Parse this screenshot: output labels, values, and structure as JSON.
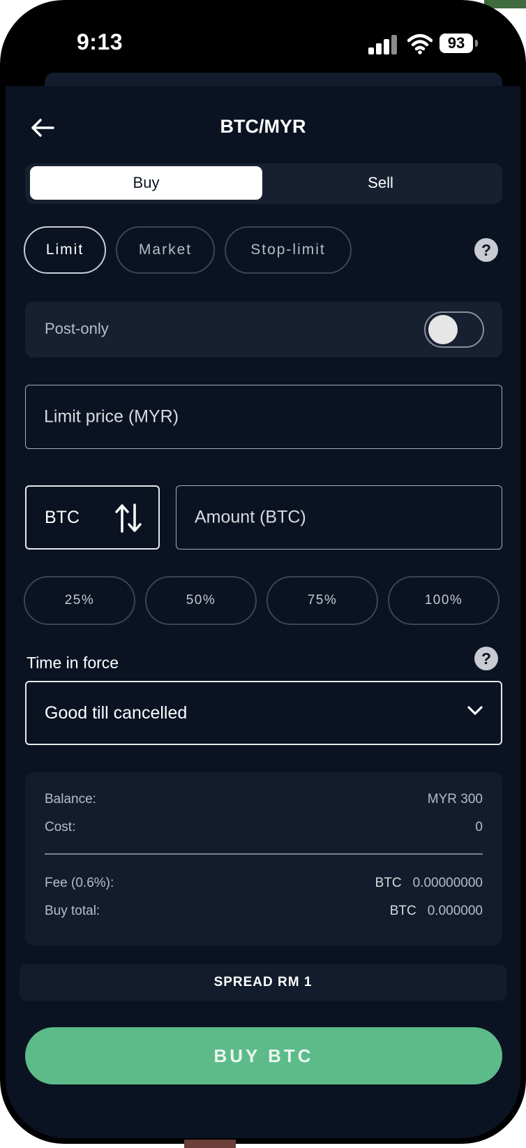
{
  "status_bar": {
    "time": "9:13",
    "battery": "93"
  },
  "header": {
    "title": "BTC/MYR"
  },
  "side_toggle": {
    "buy_label": "Buy",
    "sell_label": "Sell",
    "selected": "Buy"
  },
  "order_types": {
    "items": [
      {
        "label": "Limit",
        "active": true
      },
      {
        "label": "Market",
        "active": false
      },
      {
        "label": "Stop-limit",
        "active": false
      }
    ]
  },
  "post_only": {
    "label": "Post-only",
    "enabled": false
  },
  "limit_price": {
    "placeholder": "Limit price (MYR)"
  },
  "amount": {
    "unit": "BTC",
    "placeholder": "Amount (BTC)"
  },
  "percent_buttons": [
    "25%",
    "50%",
    "75%",
    "100%"
  ],
  "time_in_force": {
    "label": "Time in force",
    "selected": "Good till cancelled"
  },
  "summary": {
    "balance_label": "Balance:",
    "balance_value": "MYR 300",
    "cost_label": "Cost:",
    "cost_value": "0",
    "fee_label": "Fee (0.6%):",
    "fee_currency": "BTC",
    "fee_value": "0.00000000",
    "total_label": "Buy total:",
    "total_currency": "BTC",
    "total_value": "0.000000"
  },
  "spread": {
    "label": "SPREAD RM 1"
  },
  "submit": {
    "label": "BUY BTC"
  },
  "colors": {
    "background": "#0b1322",
    "buy_accent": "#5dbb8a",
    "panel": "#162030"
  }
}
